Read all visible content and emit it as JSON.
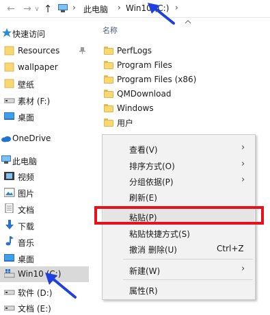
{
  "address_bar": {
    "back_arrow": "←",
    "forward_arrow": "→",
    "dropdown_chevron": "∨",
    "up_arrow": "↑",
    "separator": "›",
    "crumbs": [
      "此电脑",
      "Win10 (C:)"
    ]
  },
  "nav_pane": {
    "items": [
      {
        "label": "快速访问",
        "icon": "star-icon"
      },
      {
        "label": "Resources",
        "icon": "folder-icon",
        "pinned": true
      },
      {
        "label": "wallpaper",
        "icon": "folder-icon"
      },
      {
        "label": "壁纸",
        "icon": "folder-icon"
      },
      {
        "label": "素材 (F:)",
        "icon": "drive-icon"
      },
      {
        "label": "桌面",
        "icon": "desktop-icon"
      },
      {
        "label": "OneDrive",
        "icon": "cloud-icon"
      },
      {
        "label": "此电脑",
        "icon": "computer-icon"
      },
      {
        "label": "视频",
        "icon": "video-icon"
      },
      {
        "label": "图片",
        "icon": "picture-icon"
      },
      {
        "label": "文档",
        "icon": "document-icon"
      },
      {
        "label": "下载",
        "icon": "download-icon"
      },
      {
        "label": "音乐",
        "icon": "music-icon"
      },
      {
        "label": "桌面",
        "icon": "desktop-icon"
      },
      {
        "label": "Win10 (C:)",
        "icon": "windows-drive-icon",
        "selected": true
      },
      {
        "label": "软件 (D:)",
        "icon": "drive-icon"
      },
      {
        "label": "文档 (E:)",
        "icon": "drive-icon"
      }
    ]
  },
  "content": {
    "column_header": "名称",
    "files": [
      "PerfLogs",
      "Program Files",
      "Program Files (x86)",
      "QMDownload",
      "Windows",
      "用户"
    ]
  },
  "context_menu": {
    "items": [
      {
        "label": "查看(V)",
        "submenu": true
      },
      {
        "label": "排序方式(O)",
        "submenu": true
      },
      {
        "label": "分组依据(P)",
        "submenu": true
      },
      {
        "label": "刷新(E)"
      },
      {
        "label": "粘贴(P)",
        "highlighted": true
      },
      {
        "label": "粘贴快捷方式(S)"
      },
      {
        "label": "撤消 删除(U)",
        "shortcut": "Ctrl+Z"
      },
      {
        "label": "新建(W)",
        "submenu": true
      },
      {
        "label": "属性(R)"
      }
    ],
    "submenu_arrow": "›"
  },
  "colors": {
    "annotation_arrow": "#1f3fe0",
    "highlight_box": "#e8111a",
    "selected_bg": "#cce8ff",
    "folder": "#f8d775"
  }
}
